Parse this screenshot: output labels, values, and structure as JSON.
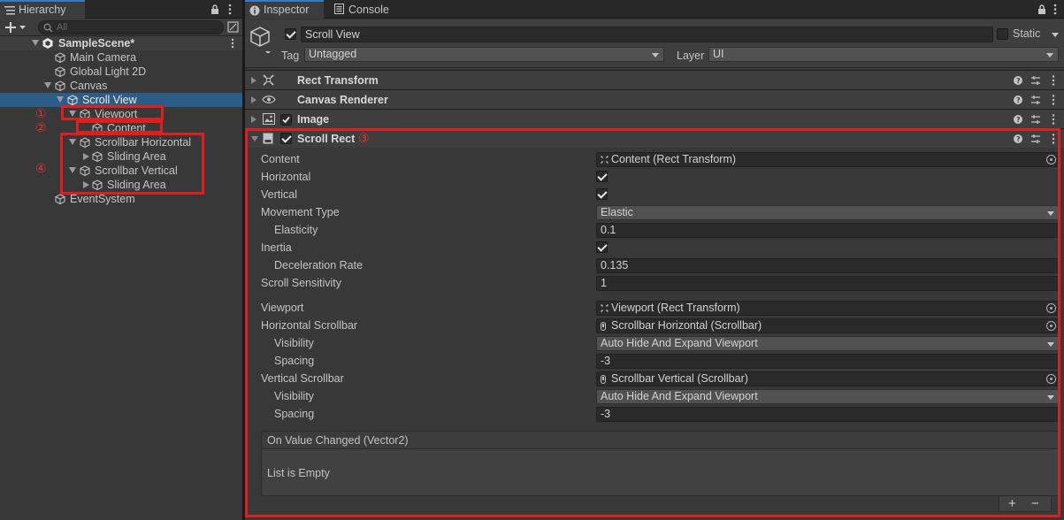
{
  "hierarchy": {
    "tab_label": "Hierarchy",
    "search_placeholder": "All",
    "scene_name": "SampleScene*",
    "items": {
      "main_camera": "Main Camera",
      "global_light": "Global Light 2D",
      "canvas": "Canvas",
      "scroll_view": "Scroll View",
      "viewport": "Viewport",
      "content": "Content",
      "scrollbar_horizontal": "Scrollbar Horizontal",
      "sliding_area_1": "Sliding Area",
      "scrollbar_vertical": "Scrollbar Vertical",
      "sliding_area_2": "Sliding Area",
      "event_system": "EventSystem"
    },
    "annotations": {
      "a1": "①",
      "a2": "②",
      "a4": "④"
    }
  },
  "inspector": {
    "tab_inspector": "Inspector",
    "tab_console": "Console",
    "object_name": "Scroll View",
    "static_label": "Static",
    "tag_label": "Tag",
    "tag_value": "Untagged",
    "layer_label": "Layer",
    "layer_value": "UI",
    "components": {
      "rect_transform": "Rect Transform",
      "canvas_renderer": "Canvas Renderer",
      "image": "Image",
      "scroll_rect": "Scroll Rect"
    },
    "annotation3": "③",
    "scroll_rect": {
      "content_label": "Content",
      "content_value": "Content (Rect Transform)",
      "horizontal_label": "Horizontal",
      "horizontal_checked": true,
      "vertical_label": "Vertical",
      "vertical_checked": true,
      "movement_type_label": "Movement Type",
      "movement_type_value": "Elastic",
      "elasticity_label": "Elasticity",
      "elasticity_value": "0.1",
      "inertia_label": "Inertia",
      "inertia_checked": true,
      "deceleration_label": "Deceleration Rate",
      "deceleration_value": "0.135",
      "sensitivity_label": "Scroll Sensitivity",
      "sensitivity_value": "1",
      "viewport_label": "Viewport",
      "viewport_value": "Viewport (Rect Transform)",
      "hscroll_label": "Horizontal Scrollbar",
      "hscroll_value": "Scrollbar Horizontal (Scrollbar)",
      "hvis_label": "Visibility",
      "hvis_value": "Auto Hide And Expand Viewport",
      "hspacing_label": "Spacing",
      "hspacing_value": "-3",
      "vscroll_label": "Vertical Scrollbar",
      "vscroll_value": "Scrollbar Vertical (Scrollbar)",
      "vvis_label": "Visibility",
      "vvis_value": "Auto Hide And Expand Viewport",
      "vspacing_label": "Spacing",
      "vspacing_value": "-3",
      "event_title": "On Value Changed (Vector2)",
      "event_empty": "List is Empty",
      "add_label": "+",
      "remove_label": "−"
    }
  },
  "colors": {
    "selection": "#2c5d87",
    "annotation_red": "#e01e1e",
    "panel_bg": "#383838"
  }
}
